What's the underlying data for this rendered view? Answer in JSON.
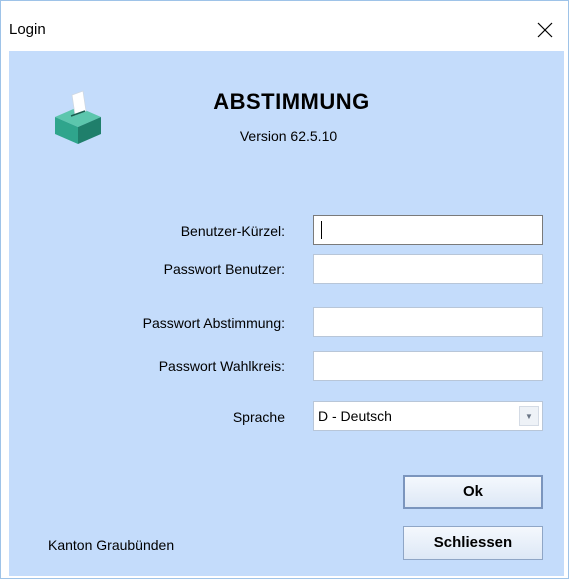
{
  "window": {
    "title": "Login"
  },
  "app": {
    "title": "ABSTIMMUNG",
    "version": "Version 62.5.10"
  },
  "form": {
    "user_short_label": "Benutzer-Kürzel:",
    "user_short_value": "",
    "user_password_label": "Passwort Benutzer:",
    "vote_password_label": "Passwort Abstimmung:",
    "district_password_label": "Passwort Wahlkreis:",
    "language_label": "Sprache",
    "language_value": "D - Deutsch"
  },
  "buttons": {
    "ok_label": "Ok",
    "close_label": "Schliessen"
  },
  "footer": {
    "canton": "Kanton Graubünden"
  },
  "colors": {
    "client_bg": "#c4dcfb",
    "icon_green": "#2fa58c"
  },
  "icons": [
    "close-icon",
    "ballot-box-icon",
    "dropdown-arrow-icon"
  ]
}
